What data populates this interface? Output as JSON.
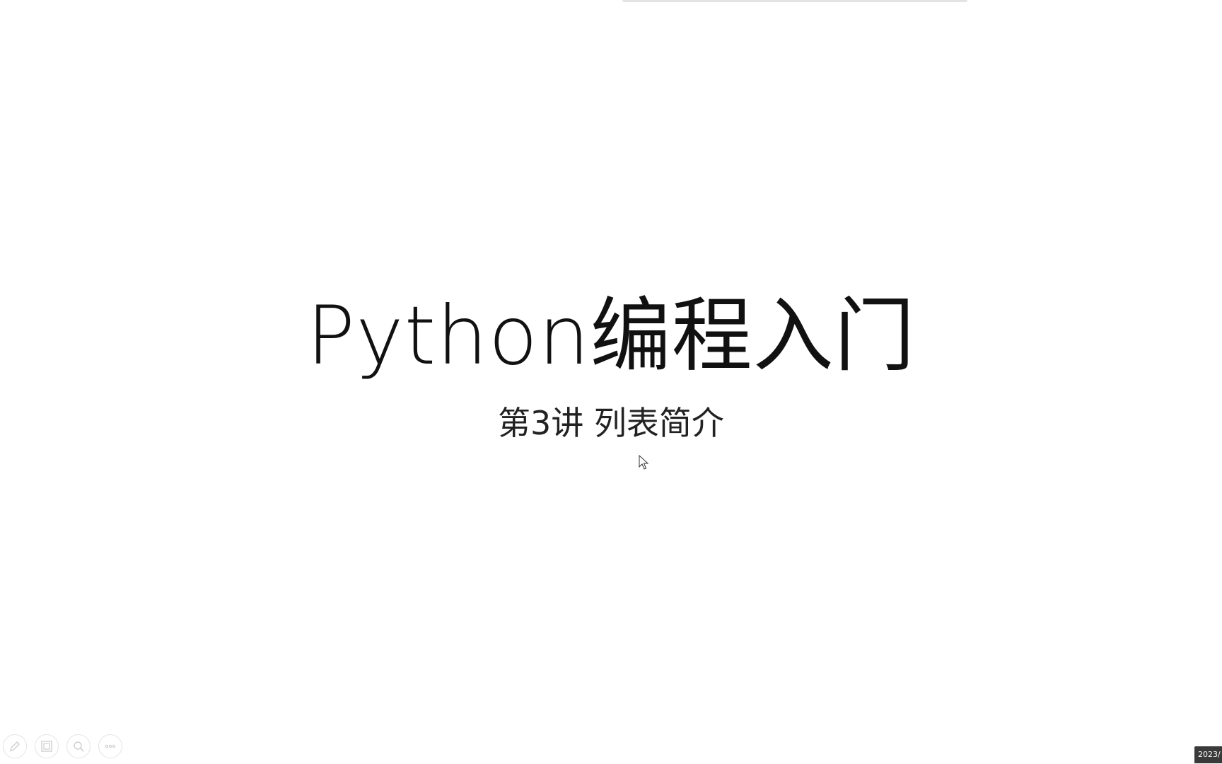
{
  "slide": {
    "title": "Python编程入门",
    "subtitle": "第3讲 列表简介"
  },
  "toolbar": {
    "items": [
      {
        "icon": "pen-icon"
      },
      {
        "icon": "slides-icon"
      },
      {
        "icon": "magnifier-icon"
      },
      {
        "icon": "more-icon"
      }
    ]
  },
  "taskbar": {
    "clock_text": "2023/"
  },
  "colors": {
    "background": "#ffffff",
    "text": "#111111",
    "toolbar_icon": "#cfcfcf",
    "clock_bg": "#3a3a3a"
  }
}
